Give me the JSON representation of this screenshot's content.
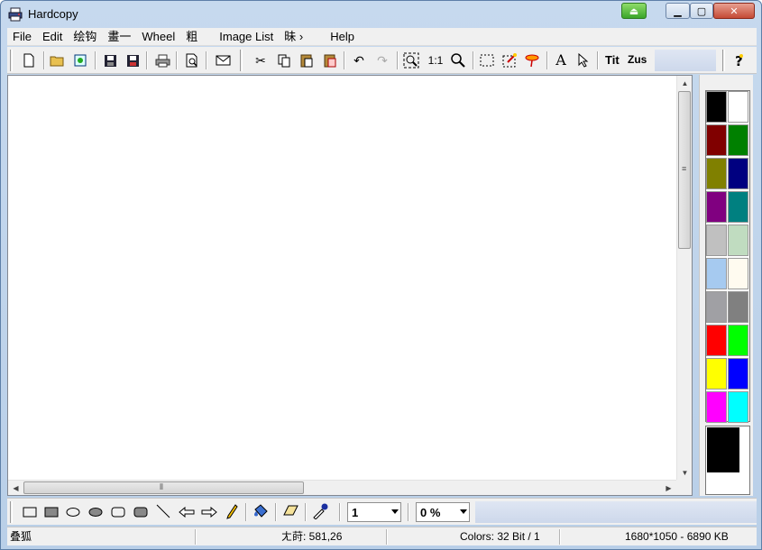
{
  "window": {
    "title": "Hardcopy",
    "app_icon": "printer-app-icon",
    "controls": [
      "minimize",
      "maximize",
      "close"
    ]
  },
  "menu": [
    "File",
    "Edit",
    "绘钩",
    "畫一",
    "Wheel",
    "粗",
    "Image List",
    "昧 ›",
    "Help"
  ],
  "toolbar": {
    "zoom_1to1": "1:1",
    "text_tit": "Tit",
    "text_zus": "Zus"
  },
  "palette": {
    "colors": [
      [
        "#000000",
        "#ffffff"
      ],
      [
        "#800000",
        "#008000"
      ],
      [
        "#808000",
        "#000080"
      ],
      [
        "#800080",
        "#008080"
      ],
      [
        "#c0c0c0",
        "#c0dcc0"
      ],
      [
        "#a6caf0",
        "#fffbf0"
      ],
      [
        "#a0a0a4",
        "#808080"
      ],
      [
        "#ff0000",
        "#00ff00"
      ],
      [
        "#ffff00",
        "#0000ff"
      ],
      [
        "#ff00ff",
        "#00ffff"
      ]
    ],
    "current_foreground": "#000000",
    "current_background": "#ffffff"
  },
  "bottom_toolbar": {
    "line_width": "1",
    "percent": "0 %"
  },
  "status": {
    "mode": "叠狐",
    "position": "ㄤ莳: 581,26",
    "colors": "Colors: 32 Bit / 1",
    "size": "1680*1050  -  6890 KB"
  }
}
